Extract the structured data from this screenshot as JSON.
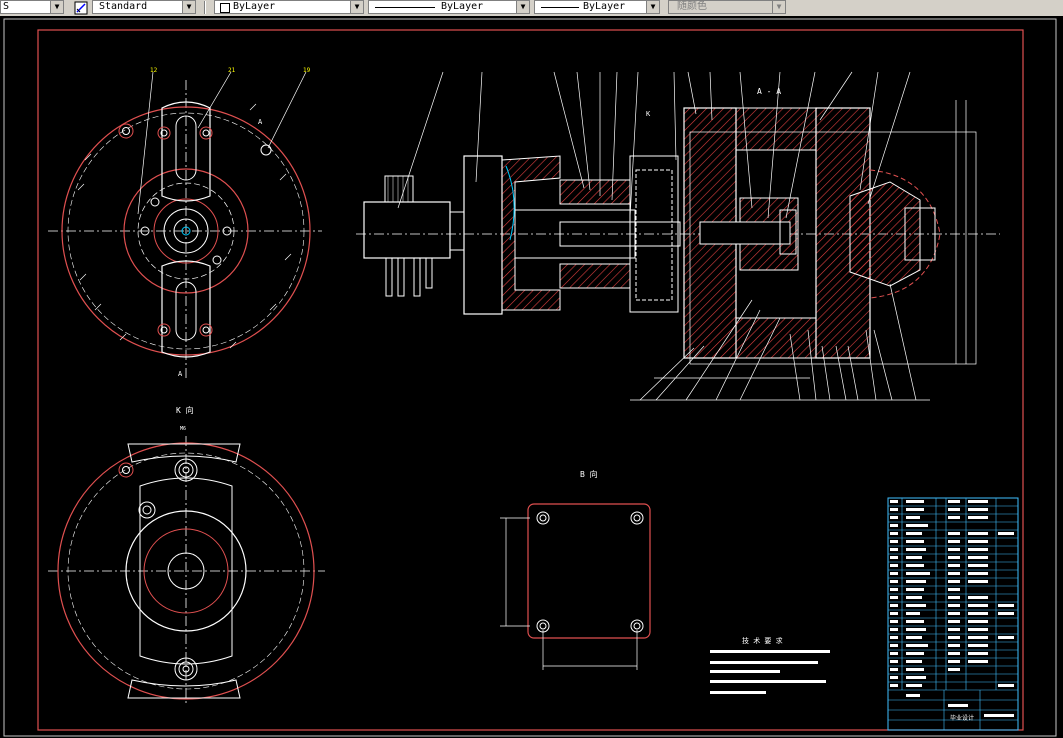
{
  "toolbar": {
    "textstyle_prefix": "S",
    "dimstyle_value": "Standard",
    "layer_value": "ByLayer",
    "linetype_value": "ByLayer",
    "lineweight_value": "ByLayer",
    "color_value": "随颜色"
  },
  "drawing": {
    "colors": {
      "background": "#000000",
      "frame": "#e05050",
      "outline": "#ffffff",
      "hatch": "#e04040",
      "centerline": "#ffffff",
      "dim": "#ffffff",
      "title_block": "#40c0ff"
    },
    "views": {
      "k_view_label": "K 向",
      "b_view_label": "B 向",
      "section_label": "A - A",
      "k_marker": "K"
    },
    "notes_title": "技 术 要 求",
    "title_block": {
      "title_text": "毕业设计"
    }
  }
}
